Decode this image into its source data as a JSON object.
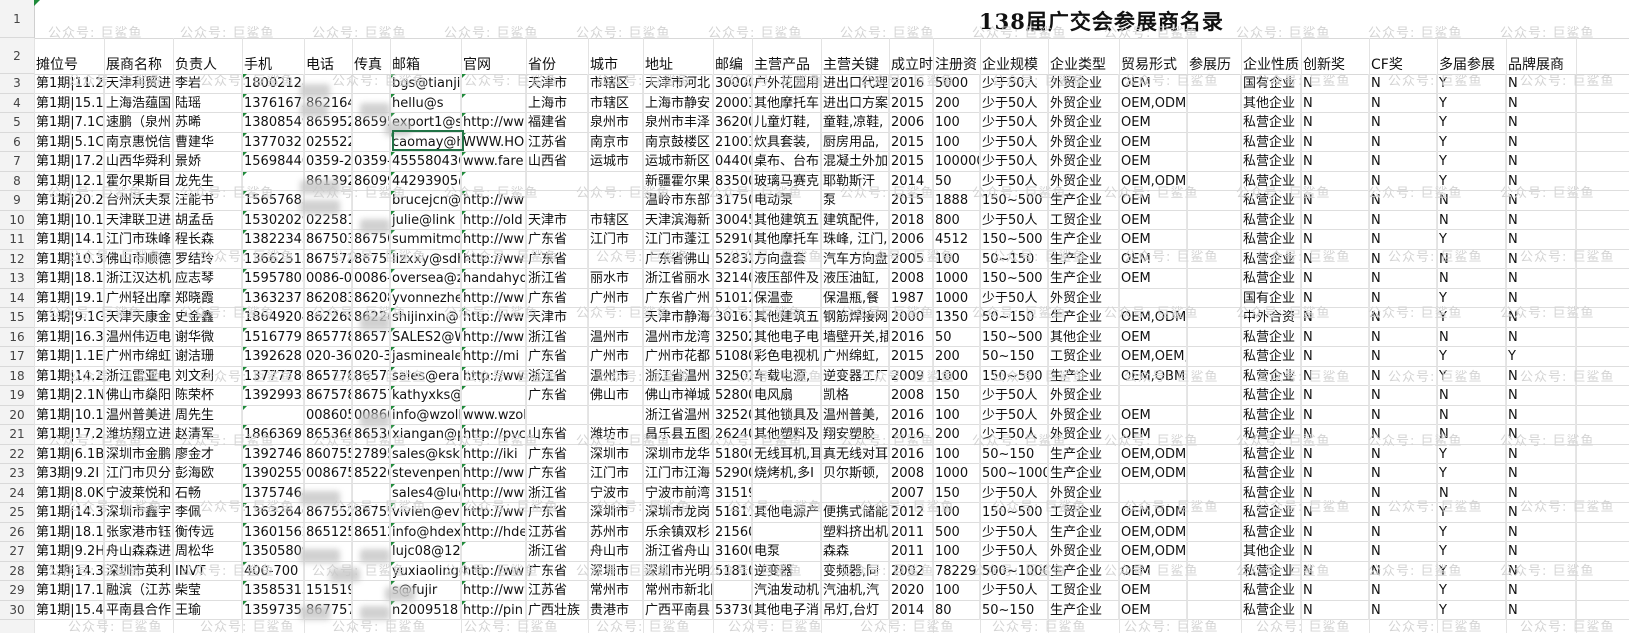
{
  "sheet_title": "138届广交会参展商名录",
  "watermark_text": "公众号: 巨鲨鱼",
  "row_numbers": [
    "1",
    "2",
    "3",
    "4",
    "5",
    "6",
    "7",
    "8",
    "9",
    "10",
    "11",
    "12",
    "13",
    "14",
    "15",
    "16",
    "17",
    "18",
    "19",
    "20",
    "21",
    "22",
    "23",
    "24",
    "25",
    "26",
    "27",
    "28",
    "29",
    "30"
  ],
  "headers": [
    "摊位号",
    "展商名称",
    "负责人",
    "手机",
    "电话",
    "传真",
    "邮箱",
    "官网",
    "省份",
    "城市",
    "地址",
    "邮编",
    "主营产品",
    "主营关键",
    "成立时",
    "注册资",
    "企业规模",
    "企业类型",
    "贸易形式",
    "参展历",
    "企业性质",
    "创新奖",
    "CF奖",
    "多届参展",
    "品牌展商"
  ],
  "rows": [
    [
      "第1期|11.2",
      "天津利贸进",
      "李岩",
      "18002128",
      "",
      "",
      "bgs@tianjinlight.com",
      "",
      "天津市",
      "市辖区",
      "天津市河北",
      "300000",
      "户外花园用",
      "进出口代理",
      "2016",
      "5000",
      "少于50人",
      "外贸企业",
      "OEM",
      "",
      "国有企业",
      "N",
      "N",
      "Y",
      "N"
    ],
    [
      "第1期|15.1",
      "上海浩蕴国",
      "陆瑶",
      "13761672",
      "8621643",
      "",
      "hellu@s",
      "",
      "上海市",
      "市辖区",
      "上海市静安",
      "200031",
      "其他摩托车",
      "进出口方案",
      "2015",
      "200",
      "少于50人",
      "外贸企业",
      "OEM,ODM,OEM",
      "",
      "其他企业",
      "N",
      "N",
      "Y",
      "N"
    ],
    [
      "第1期|7.1C",
      "速鹏（泉州",
      "苏晞",
      "13808549",
      "8659522",
      "865952",
      "export1@s",
      "http://ww",
      "福建省",
      "泉州市",
      "泉州市丰泽",
      "362000",
      "儿童灯鞋,",
      "童鞋,凉鞋,",
      "2006",
      "100",
      "少于50人",
      "外贸企业",
      "OEM",
      "",
      "私营企业",
      "N",
      "N",
      "Y",
      "N"
    ],
    [
      "第1期|5.1C",
      "南京惠悦信",
      "曹建华",
      "13770327",
      "0255221",
      "",
      "caomay@h",
      "WWW.HO",
      "江苏省",
      "南京市",
      "南京鼓楼区",
      "210036",
      "炊具套装,",
      "厨房用品,",
      "2015",
      "100",
      "少于50人",
      "外贸企业",
      "OEM",
      "",
      "私营企业",
      "N",
      "N",
      "Y",
      "N"
    ],
    [
      "第1期|17.2",
      "山西华舜利",
      "景娇",
      "15698440",
      "0359-26",
      "0359-2",
      "455580436",
      "www.fare",
      "山西省",
      "运城市",
      "运城市新区",
      "044000",
      "桌布、台布",
      "混凝土外加",
      "2015",
      "100000",
      "少于50人",
      "外贸企业",
      "OEM",
      "",
      "私营企业",
      "N",
      "N",
      "Y",
      "N"
    ],
    [
      "第1期|12.1",
      "霍尔果斯目",
      "龙先生",
      "",
      "8613928",
      "860995",
      "44293905@qq.com",
      "",
      "",
      "",
      "新疆霍尔果",
      "835000",
      "玻璃马赛克",
      "耶勒斯汗",
      "2014",
      "50",
      "少于50人",
      "外贸企业",
      "OEM,ODM,OBM",
      "",
      "私营企业",
      "N",
      "N",
      "Y",
      "N"
    ],
    [
      "第1期|20.2",
      "台州沃夫泵",
      "汪能书",
      "15657685",
      "",
      "",
      "brucejcn@",
      "http://www.wolfsonpump.co",
      "",
      "",
      "温岭市东部",
      "317500",
      "电动泵",
      "泵",
      "2015",
      "1888",
      "150~500",
      "生产企业",
      "OEM",
      "",
      "私营企业",
      "N",
      "N",
      "N",
      "N"
    ],
    [
      "第1期|10.1",
      "天津联卫进",
      "胡孟岳",
      "15302029",
      "0225817",
      "",
      "julie@link",
      "http://old",
      "天津市",
      "市辖区",
      "天津滨海新",
      "300457",
      "其他建筑五",
      "建筑配件,",
      "2018",
      "800",
      "少于50人",
      "工贸企业",
      "OEM",
      "",
      "私营企业",
      "N",
      "N",
      "N",
      "N"
    ],
    [
      "第1期|14.1",
      "江门市珠峰",
      "程长森",
      "13822345",
      "8675033",
      "867503",
      "summitmot",
      "http://ww",
      "广东省",
      "江门市",
      "江门市蓬江",
      "529100",
      "其他摩托车",
      "珠峰, 江门,",
      "2006",
      "4512",
      "150~500",
      "生产企业",
      "OEM",
      "",
      "私营企业",
      "N",
      "N",
      "Y",
      "N"
    ],
    [
      "第1期|10.3",
      "佛山市顺德",
      "罗结玲",
      "13662513",
      "8675727",
      "867572",
      "lizxxy@sdh",
      "http://www.hombest.net",
      "广东省",
      "",
      "广东省佛山",
      "528325",
      "方向盘套",
      "汽车方向盘",
      "2005",
      "100",
      "50~150",
      "生产企业",
      "OEM",
      "",
      "私营企业",
      "N",
      "N",
      "N",
      "N"
    ],
    [
      "第1期|18.1",
      "浙江汉达机",
      "应志琴",
      "15957805",
      "0086-05",
      "0086-0",
      "oversea@z",
      "handahyd",
      "浙江省",
      "丽水市",
      "浙江省丽水",
      "321404",
      "液压部件及",
      "液压油缸,",
      "2008",
      "1000",
      "150~500",
      "生产企业",
      "OEM",
      "",
      "私营企业",
      "N",
      "N",
      "N",
      "N"
    ],
    [
      "第1期|19.1",
      "广州轻出摩",
      "郑晓霞",
      "13632371",
      "8620833",
      "862083",
      "yvonnezhe",
      "http://ww",
      "广东省",
      "广州市",
      "广东省广州",
      "510120",
      "保温壶",
      "保温瓶,餐",
      "1987",
      "1000",
      "少于50人",
      "外贸企业",
      "",
      "",
      "国有企业",
      "N",
      "N",
      "Y",
      "N"
    ],
    [
      "第1期|9.1G",
      "天津天康金",
      "史金鑫",
      "18649204",
      "8622685",
      "862268",
      "shijinxin@",
      "http://ww",
      "天津市",
      "",
      "天津市静海",
      "301636",
      "其他建筑五",
      "钢筋焊接网",
      "2000",
      "1350",
      "50~150",
      "生产企业",
      "OEM,ODM",
      "",
      "中外合资",
      "N",
      "N",
      "Y",
      "N"
    ],
    [
      "第1期|16.3",
      "温州伟迈电",
      "谢华微",
      "15167791",
      "8657786",
      "865778",
      "SALES2@W",
      "http://ww",
      "浙江省",
      "温州市",
      "温州市龙湾",
      "325025",
      "其他电子电",
      "墙壁开关,插",
      "2016",
      "50",
      "150~500",
      "其他企业",
      "OEM",
      "",
      "私营企业",
      "N",
      "N",
      "N",
      "N"
    ],
    [
      "第1期|1.1E",
      "广州市绵虹",
      "谢洁珊",
      "13926281",
      "020-369",
      "020-36",
      "jasmineale",
      "http://mi",
      "广东省",
      "广州市",
      "广州市花都",
      "510800",
      "彩色电视机",
      "广州绵虹,",
      "2015",
      "200",
      "50~150",
      "工贸企业",
      "OEM,OEM,OBM",
      "",
      "私营企业",
      "N",
      "N",
      "Y",
      "Y"
    ],
    [
      "第1期|14.2",
      "浙江雷亚电",
      "刘文利",
      "13777780",
      "8657786",
      "865778",
      "sales@eray",
      "http://ww",
      "浙江省",
      "温州市",
      "浙江省温州",
      "325025",
      "车载电源,",
      "逆变器工厂",
      "2009",
      "1000",
      "150~500",
      "生产企业",
      "OEM,OBM,ODM",
      "",
      "私营企业",
      "N",
      "N",
      "Y",
      "N"
    ],
    [
      "第1期|2.1N",
      "佛山市燊阳",
      "陈荣杯",
      "13929932",
      "8675783",
      "867578",
      "kathyxks@163.com",
      "",
      "广东省",
      "佛山市",
      "佛山市禅城",
      "528000",
      "电风扇",
      "凯格",
      "2008",
      "150",
      "少于50人",
      "外贸企业",
      "",
      "",
      "私营企业",
      "N",
      "N",
      "N",
      "N"
    ],
    [
      "第1期|10.1",
      "温州普美进",
      "周先生",
      "",
      "0086057",
      "008605",
      "info@wzoll",
      "www.wzollie.com",
      "",
      "",
      "浙江省温州",
      "325204",
      "其他锁具及",
      "温州普美,",
      "2016",
      "100",
      "少于50人",
      "外贸企业",
      "OEM",
      "",
      "私营企业",
      "N",
      "N",
      "N",
      "N"
    ],
    [
      "第1期|17.2",
      "潍坊翔立进",
      "赵清军",
      "18663691",
      "8653662",
      "865366",
      "xiangan@p",
      "http://pvc",
      "山东省",
      "潍坊市",
      "昌乐县五图",
      "262400",
      "其他塑料及",
      "翔安塑胶",
      "2016",
      "200",
      "少于50人",
      "外贸企业",
      "OEM",
      "",
      "私营企业",
      "N",
      "N",
      "N",
      "N"
    ],
    [
      "第1期|6.1B",
      "深圳市金鹏",
      "廖金才",
      "13927467",
      "8607558",
      "278956",
      "sales@kski",
      "http://iki",
      "广东省",
      "深圳市",
      "深圳市龙华",
      "518000",
      "无线耳机,耳",
      "真无线对耳",
      "2016",
      "100",
      "50~150",
      "生产企业",
      "OEM,ODM",
      "",
      "私营企业",
      "N",
      "N",
      "Y",
      "N"
    ],
    [
      "第3期|9.2I",
      "江门市贝分",
      "彭海欧",
      "13902559",
      "0086750",
      "852260",
      "stevenpeng",
      "http://ww",
      "广东省",
      "江门市",
      "江门市江海",
      "529000",
      "烧烤机,多I",
      "贝尔斯顿,",
      "2008",
      "1000",
      "500~1000",
      "生产企业",
      "OEM,ODM",
      "",
      "私营企业",
      "N",
      "N",
      "Y",
      "N"
    ],
    [
      "第1期|8.0K",
      "宁波莱悦和",
      "石畅",
      "13757468",
      "",
      "",
      "sales4@luc",
      "http://www.luck",
      "浙江省",
      "宁波市",
      "宁波市前湾",
      "315199",
      "",
      "",
      "2007",
      "150",
      "少于50人",
      "外贸企业",
      "",
      "",
      "私营企业",
      "N",
      "N",
      "N",
      "N"
    ],
    [
      "第1期|14.3",
      "深圳市鑫宇",
      "李佩",
      "13632640",
      "8675529",
      "867552",
      "vivien@eve",
      "http://ww",
      "广东省",
      "深圳市",
      "深圳市龙岗",
      "518116",
      "其他电源产",
      "便携式储能",
      "2012",
      "100",
      "150~500",
      "工贸企业",
      "OEM,ODM",
      "",
      "私营企业",
      "N",
      "N",
      "Y",
      "N"
    ],
    [
      "第1期|18.1",
      "张家港市钰",
      "衡传远",
      "13601562",
      "8651258",
      "865125",
      "info@hdex",
      "http://hde",
      "江苏省",
      "苏州市",
      "乐余镇双杉",
      "215600",
      "",
      "塑料挤出机",
      "2011",
      "500",
      "少于50人",
      "生产企业",
      "OEM,ODM",
      "",
      "私营企业",
      "N",
      "N",
      "Y",
      "N"
    ],
    [
      "第1期|9.2H",
      "舟山森森进",
      "周松华",
      "13505809",
      "",
      "",
      "lujc08@126.com",
      "",
      "浙江省",
      "舟山市",
      "浙江省舟山",
      "316000",
      "电泵",
      "森森",
      "2011",
      "100",
      "少于50人",
      "外贸企业",
      "OEM,ODM,OEM",
      "",
      "其他企业",
      "N",
      "N",
      "Y",
      "N"
    ],
    [
      "第1期|14.3",
      "深圳市英利",
      "INVT",
      "400-700",
      "",
      "",
      "yuxiaoling@",
      "http://ww",
      "广东省",
      "深圳市",
      "深圳市光明",
      "518106",
      "逆变器",
      "变频器,同",
      "2002",
      "78229",
      "500~1000",
      "生产企业",
      "OEM",
      "",
      "私营企业",
      "N",
      "N",
      "Y",
      "N"
    ],
    [
      "第1期|17.1",
      "融滨（江苏",
      "柴莹",
      "13585313",
      "1515196",
      "",
      "s@fujir",
      "http://www.fujir",
      "江苏省",
      "常州市",
      "常州市新北区长",
      "",
      "汽油发动机",
      "汽油机,汽",
      "2020",
      "100",
      "少于50人",
      "工贸企业",
      "OEM",
      "",
      "私营企业",
      "N",
      "N",
      "Y",
      "N"
    ],
    [
      "第1期|15.4",
      "平南县合作",
      "王瑜",
      "13597356",
      "8677576",
      "",
      "n2009518",
      "http://pin",
      "广西壮族",
      "贵港市",
      "广西平南县",
      "537300",
      "其他电子消",
      "吊灯,台灯",
      "2014",
      "80",
      "50~150",
      "生产企业",
      "OEM",
      "",
      "私营企业",
      "N",
      "N",
      "Y",
      "N"
    ]
  ]
}
